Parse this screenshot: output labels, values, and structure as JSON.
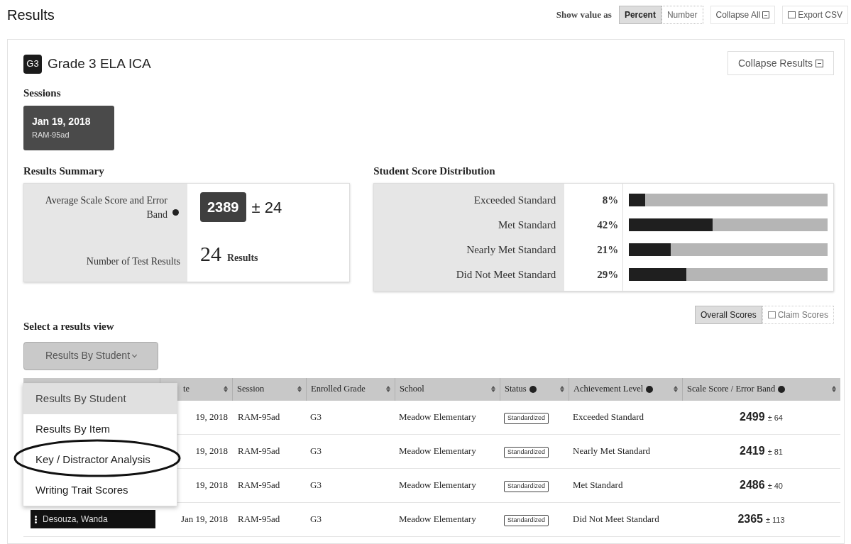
{
  "page_title": "Results",
  "toolbar": {
    "label": "Show value as",
    "value_options": [
      {
        "label": "Percent",
        "selected": true
      },
      {
        "label": "Number",
        "selected": false
      }
    ],
    "buttons": [
      {
        "label": "Collapse All",
        "kind": "collapse"
      },
      {
        "label": "Export CSV",
        "kind": "export"
      }
    ]
  },
  "assessment": {
    "badge": "G3",
    "title": "Grade 3 ELA ICA",
    "collapse_button": "Collapse Results"
  },
  "sessions": {
    "heading": "Sessions",
    "items": [
      {
        "date": "Jan 19, 2018",
        "code": "RAM-95ad",
        "selected": true
      }
    ]
  },
  "results_summary": {
    "heading": "Results Summary",
    "average_label": "Average Scale Score and Error Band",
    "average_score": "2389",
    "average_band": "± 24",
    "count_label": "Number of Test Results",
    "count": "24",
    "count_unit": "Results"
  },
  "score_distribution": {
    "heading": "Student Score Distribution",
    "rows": [
      {
        "label": "Exceeded Standard",
        "percent": "8%",
        "level": 0.08
      },
      {
        "label": "Met Standard",
        "percent": "42%",
        "level": 0.42
      },
      {
        "label": "Nearly Met Standard",
        "percent": "21%",
        "level": 0.21
      },
      {
        "label": "Did Not Meet Standard",
        "percent": "29%",
        "level": 0.29
      }
    ]
  },
  "score_views": [
    {
      "label": "Overall Scores",
      "selected": true
    },
    {
      "label": "Claim Scores",
      "selected": false
    }
  ],
  "results_view": {
    "heading": "Select a results view",
    "dropdown": "Results By Student",
    "menu": [
      {
        "label": "Results By Student",
        "selected": true
      },
      {
        "label": "Results By Item",
        "selected": false
      },
      {
        "label": "Key / Distractor Analysis",
        "selected": false
      },
      {
        "label": "Writing Trait Scores",
        "selected": false
      }
    ]
  },
  "table": {
    "columns": [
      {
        "label": "te",
        "info": false
      },
      {
        "label": "Session",
        "info": false
      },
      {
        "label": "Enrolled Grade",
        "info": false
      },
      {
        "label": "School",
        "info": false
      },
      {
        "label": "Status",
        "info": true
      },
      {
        "label": "Achievement Level",
        "info": true
      },
      {
        "label": "Scale Score / Error Band",
        "info": true
      }
    ],
    "rows": [
      {
        "date": "19, 2018",
        "session": "RAM-95ad",
        "grade": "G3",
        "school": "Meadow Elementary",
        "status": "Standardized",
        "achievement": "Exceeded Standard",
        "score": "2499",
        "band": "± 64"
      },
      {
        "date": "19, 2018",
        "session": "RAM-95ad",
        "grade": "G3",
        "school": "Meadow Elementary",
        "status": "Standardized",
        "achievement": "Nearly Met Standard",
        "score": "2419",
        "band": "± 81"
      },
      {
        "date": "19, 2018",
        "session": "RAM-95ad",
        "grade": "G3",
        "school": "Meadow Elementary",
        "status": "Standardized",
        "achievement": "Met Standard",
        "score": "2486",
        "band": "± 40"
      },
      {
        "student": "Desouza, Wanda",
        "date": "Jan 19, 2018",
        "session": "RAM-95ad",
        "grade": "G3",
        "school": "Meadow Elementary",
        "status": "Standardized",
        "achievement": "Did Not Meet Standard",
        "score": "2365",
        "band": "± 113"
      }
    ]
  }
}
